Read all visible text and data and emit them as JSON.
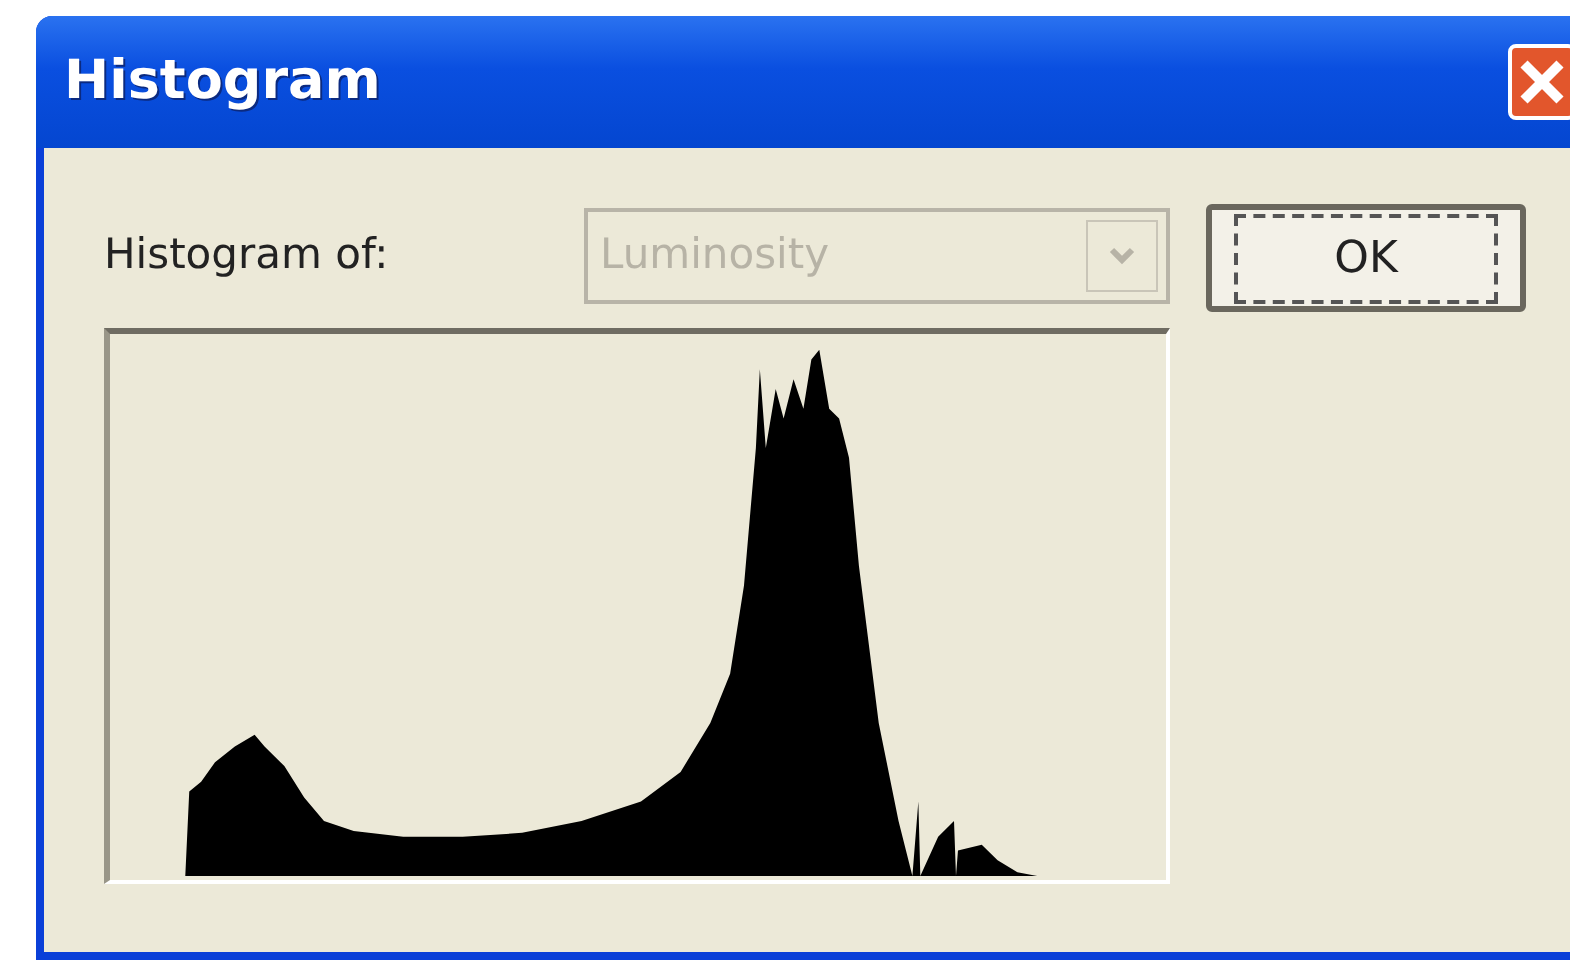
{
  "window": {
    "title": "Histogram"
  },
  "histogram_of": {
    "label": "Histogram of:",
    "value": "Luminosity",
    "disabled": true
  },
  "ok_button": {
    "label": "OK",
    "focused": true
  }
}
